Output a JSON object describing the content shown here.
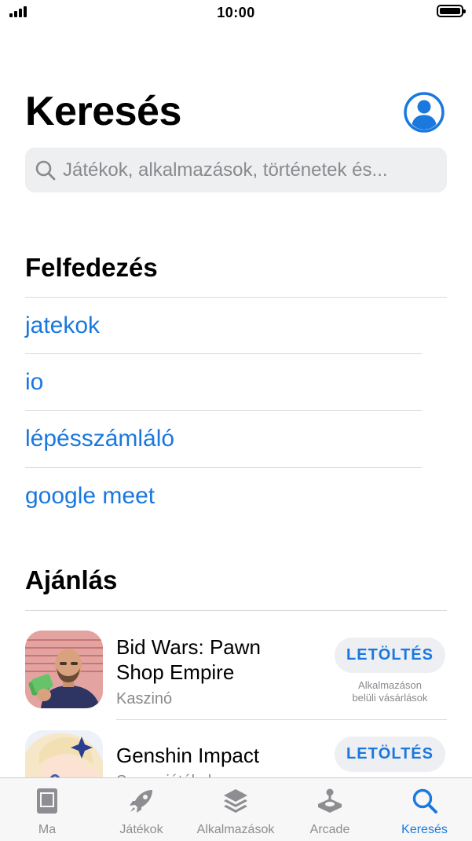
{
  "status_bar": {
    "time": "10:00"
  },
  "header": {
    "title": "Keresés"
  },
  "search": {
    "placeholder": "Játékok, alkalmazások, történetek és..."
  },
  "explore": {
    "title": "Felfedezés",
    "items": [
      "jatekok",
      "io",
      "lépésszámláló",
      "google meet"
    ]
  },
  "suggested": {
    "title": "Ajánlás",
    "apps": [
      {
        "name_line1": "Bid Wars: Pawn",
        "name_line2": "Shop Empire",
        "category": "Kaszinó",
        "button": "LETÖLTÉS",
        "iap_line1": "Alkalmazáson",
        "iap_line2": "belüli vásárlások"
      },
      {
        "name_line1": "Genshin Impact",
        "category": "Szerepjátékok",
        "button": "LETÖLTÉS"
      }
    ]
  },
  "tab_bar": {
    "tabs": [
      {
        "label": "Ma",
        "icon": "today-icon"
      },
      {
        "label": "Játékok",
        "icon": "rocket-icon"
      },
      {
        "label": "Alkalmazások",
        "icon": "layers-icon"
      },
      {
        "label": "Arcade",
        "icon": "joystick-icon"
      },
      {
        "label": "Keresés",
        "icon": "search-icon",
        "active": true
      }
    ]
  },
  "colors": {
    "accent": "#1a78de",
    "inactive": "#8d8d92",
    "search_bg": "#eeeff1"
  }
}
